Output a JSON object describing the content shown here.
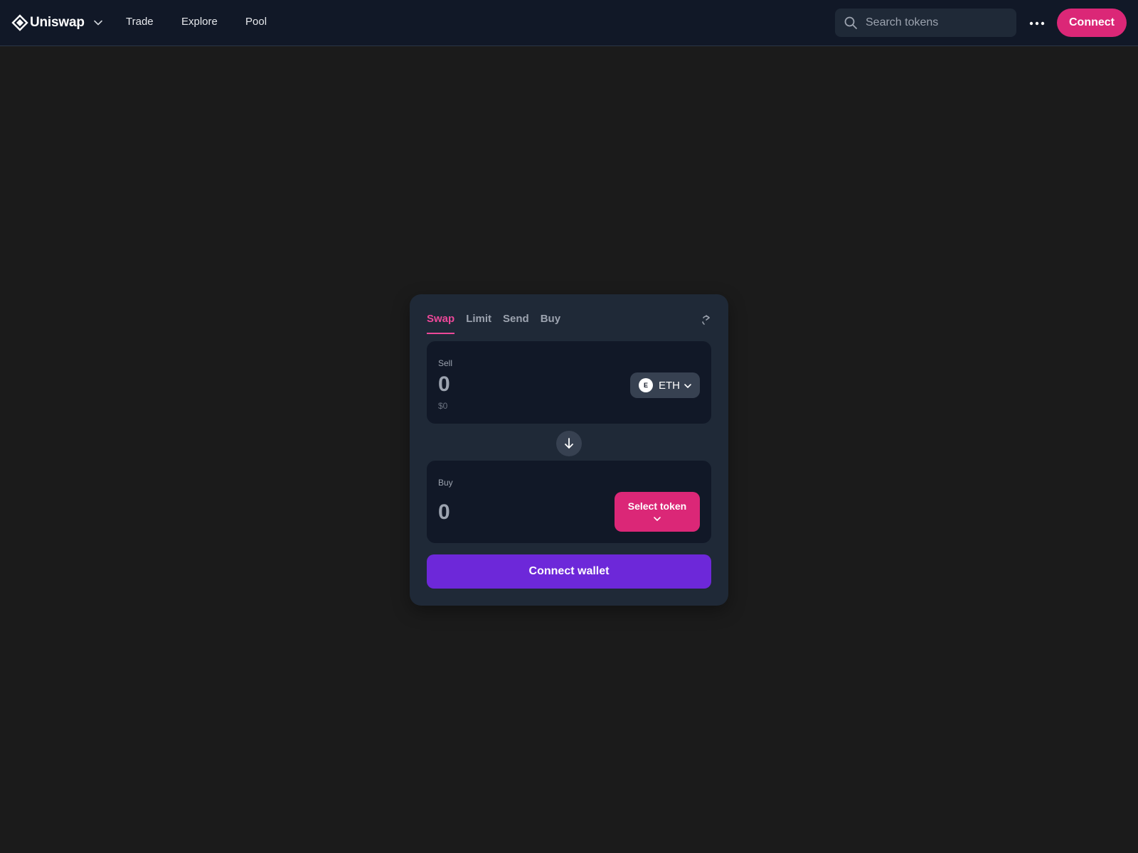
{
  "header": {
    "brand": "Uniswap",
    "nav": {
      "trade": "Trade",
      "explore": "Explore",
      "pool": "Pool"
    },
    "search": {
      "placeholder": "Search tokens",
      "value": ""
    },
    "more_icon": "more-horizontal-icon",
    "connect_label": "Connect"
  },
  "swap": {
    "tabs": {
      "swap": "Swap",
      "limit": "Limit",
      "send": "Send",
      "buy": "Buy"
    },
    "active_tab": "Swap",
    "sell": {
      "label": "Sell",
      "amount": "0",
      "usd_value": "$0",
      "token": {
        "logo_letter": "E",
        "symbol": "ETH"
      }
    },
    "buy": {
      "label": "Buy",
      "amount": "0",
      "select_token_label": "Select token"
    },
    "connect_wallet_label": "Connect wallet"
  },
  "colors": {
    "page_background": "#1b1b1b",
    "header_background": "#111827",
    "card_background": "#1f2937",
    "panel_background": "#111827",
    "accent_pink": "#db2777",
    "active_tab_pink": "#ec4899",
    "wallet_purple": "#6d28d9",
    "muted_text": "#9ca3af"
  }
}
